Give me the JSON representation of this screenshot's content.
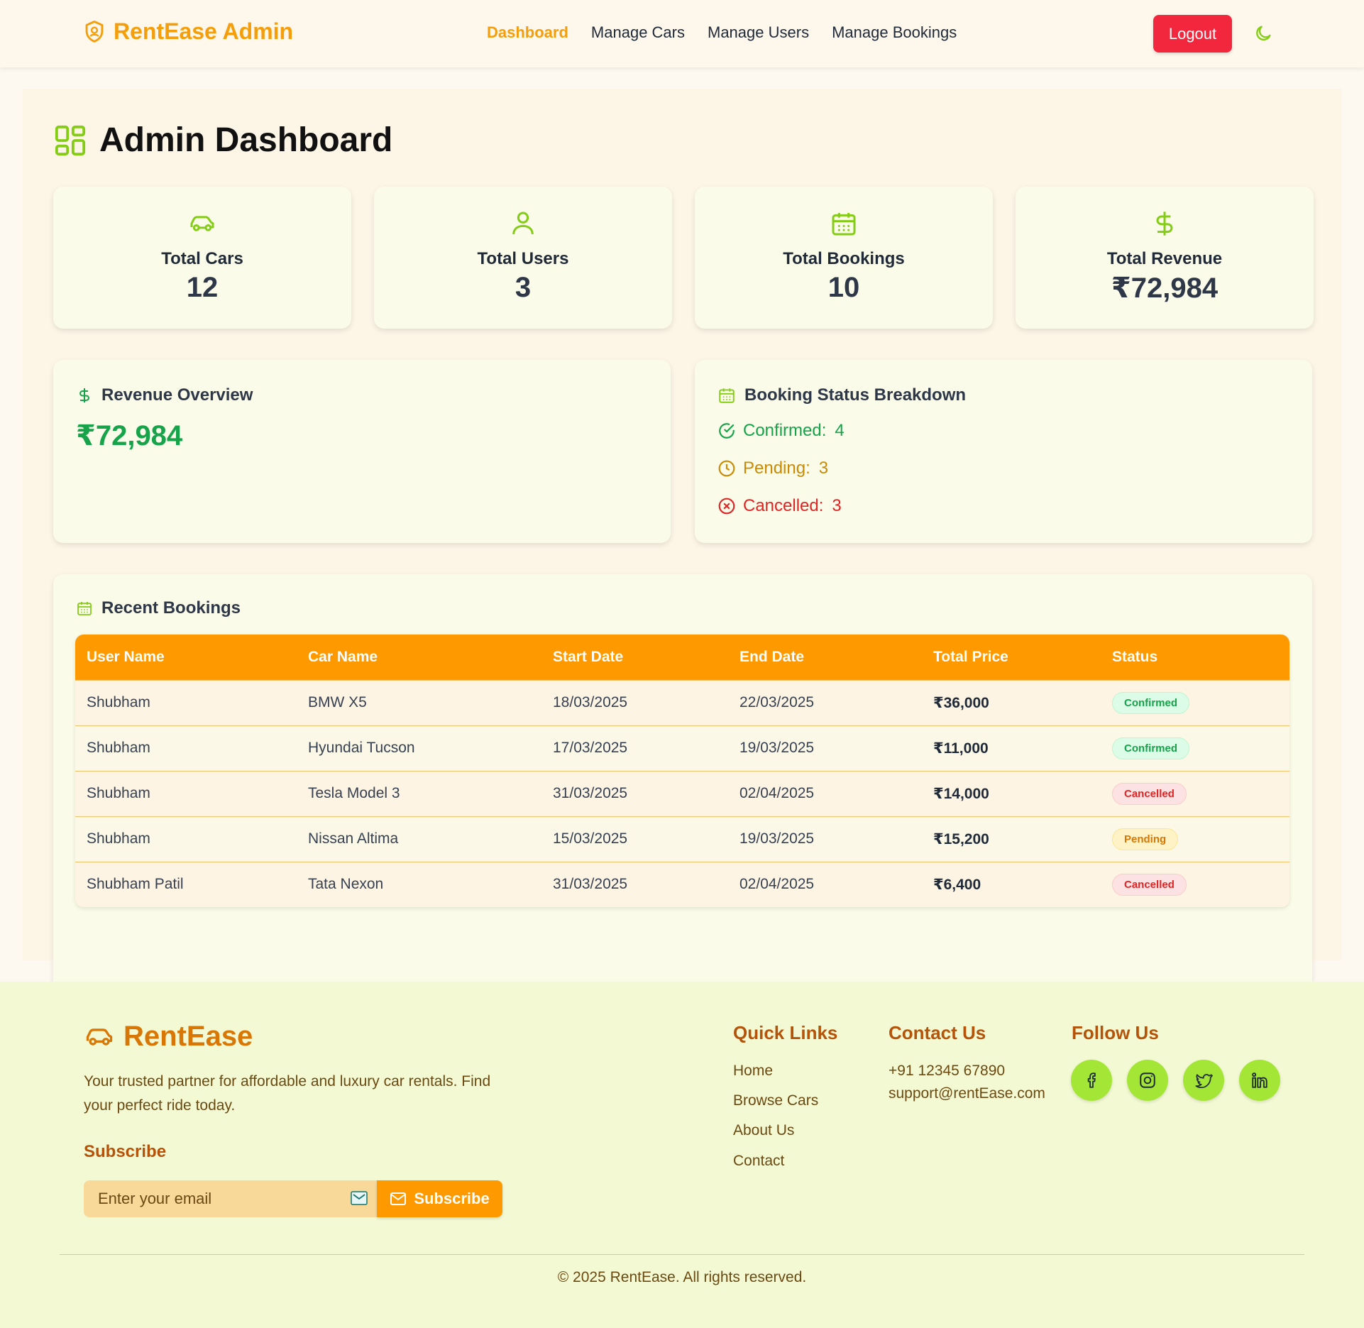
{
  "navbar": {
    "brand": "RentEase Admin",
    "links": [
      {
        "label": "Dashboard",
        "active": true
      },
      {
        "label": "Manage Cars",
        "active": false
      },
      {
        "label": "Manage Users",
        "active": false
      },
      {
        "label": "Manage Bookings",
        "active": false
      }
    ],
    "logout_label": "Logout",
    "theme_icon": "moon-icon"
  },
  "page": {
    "title": "Admin Dashboard",
    "title_icon": "dashboard-grid-icon"
  },
  "stats": [
    {
      "icon": "car-icon",
      "label": "Total Cars",
      "value": "12"
    },
    {
      "icon": "user-icon",
      "label": "Total Users",
      "value": "3"
    },
    {
      "icon": "calendar-icon",
      "label": "Total Bookings",
      "value": "10"
    },
    {
      "icon": "dollar-icon",
      "label": "Total Revenue",
      "value": "₹72,984"
    }
  ],
  "revenue_overview": {
    "title": "Revenue Overview",
    "value": "₹72,984"
  },
  "booking_status": {
    "title": "Booking Status Breakdown",
    "items": [
      {
        "label": "Confirmed:",
        "value": "4",
        "color": "#16a34a",
        "icon": "check-circle-icon"
      },
      {
        "label": "Pending:",
        "value": "3",
        "color": "#ca8a04",
        "icon": "clock-icon"
      },
      {
        "label": "Cancelled:",
        "value": "3",
        "color": "#dc2626",
        "icon": "x-circle-icon"
      }
    ]
  },
  "recent_bookings": {
    "title": "Recent Bookings",
    "columns": [
      "User Name",
      "Car Name",
      "Start Date",
      "End Date",
      "Total Price",
      "Status"
    ],
    "rows": [
      {
        "user": "Shubham",
        "car": "BMW X5",
        "start": "18/03/2025",
        "end": "22/03/2025",
        "price": "₹36,000",
        "status": "Confirmed"
      },
      {
        "user": "Shubham",
        "car": "Hyundai Tucson",
        "start": "17/03/2025",
        "end": "19/03/2025",
        "price": "₹11,000",
        "status": "Confirmed"
      },
      {
        "user": "Shubham",
        "car": "Tesla Model 3",
        "start": "31/03/2025",
        "end": "02/04/2025",
        "price": "₹14,000",
        "status": "Cancelled"
      },
      {
        "user": "Shubham",
        "car": "Nissan Altima",
        "start": "15/03/2025",
        "end": "19/03/2025",
        "price": "₹15,200",
        "status": "Pending"
      },
      {
        "user": "Shubham Patil",
        "car": "Tata Nexon",
        "start": "31/03/2025",
        "end": "02/04/2025",
        "price": "₹6,400",
        "status": "Cancelled"
      }
    ]
  },
  "footer": {
    "brand": "RentEase",
    "tagline": "Your trusted partner for affordable and luxury car rentals. Find your perfect ride today.",
    "subscribe_title": "Subscribe",
    "email_placeholder": "Enter your email",
    "subscribe_label": "Subscribe",
    "quick_links_title": "Quick Links",
    "quick_links": [
      "Home",
      "Browse Cars",
      "About Us",
      "Contact"
    ],
    "contact_title": "Contact Us",
    "phone": "+91 12345 67890",
    "email": "support@rentEase.com",
    "follow_title": "Follow Us",
    "socials": [
      "facebook-icon",
      "instagram-icon",
      "twitter-icon",
      "linkedin-icon"
    ],
    "copyright": "© 2025 RentEase. All rights reserved."
  }
}
